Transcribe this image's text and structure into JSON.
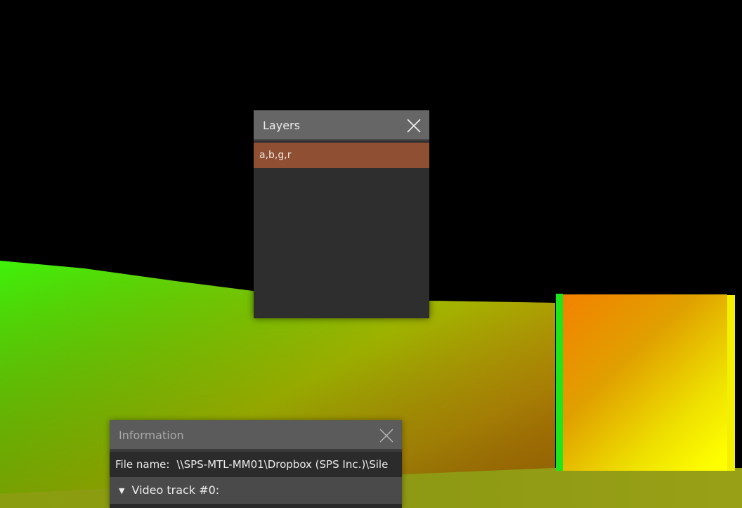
{
  "layers_panel": {
    "title": "Layers",
    "close_icon": "close-icon",
    "layers": [
      {
        "label": "a,b,g,r",
        "selected": true
      }
    ],
    "colors": {
      "header": "#666666",
      "body": "#2e2e2e",
      "selected_row": "#8f4f33"
    }
  },
  "info_panel": {
    "title": "Information",
    "close_icon": "close-icon",
    "file_label": "File name:",
    "file_value": "\\\\SPS-MTL-MM01\\Dropbox (SPS Inc.)\\Sile",
    "track_toggle_icon": "triangle-down-icon",
    "track_label": "Video track #0:"
  },
  "scene": {
    "description_colors": {
      "background": "#000000",
      "terrain_left": "#3ff20a",
      "terrain_mid": "#b8e800",
      "ground_bottom": "#8a9a12",
      "box_orange": "#f08c00",
      "box_yellow": "#ffff00",
      "box_edge_green": "#1ee61e"
    }
  }
}
